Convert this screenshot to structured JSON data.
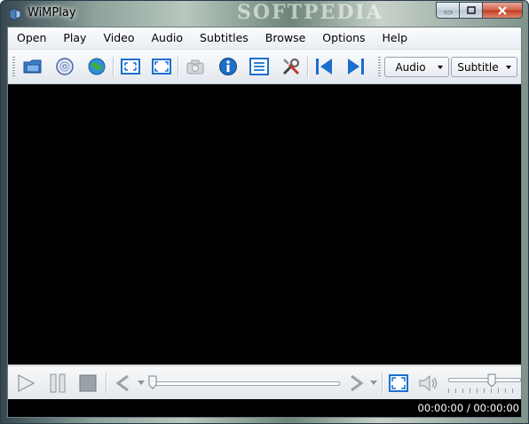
{
  "window": {
    "title": "WiMPlay"
  },
  "watermark": "SOFTPEDIA",
  "menu": [
    "Open",
    "Play",
    "Video",
    "Audio",
    "Subtitles",
    "Browse",
    "Options",
    "Help"
  ],
  "toolbar": {
    "audio_label": "Audio",
    "subtitle_label": "Subtitle"
  },
  "status": {
    "time": "00:00:00 / 00:00:00"
  },
  "seek": {
    "position": 0
  },
  "volume": {
    "level": 0.6
  },
  "icons": {
    "open": "folder-icon",
    "disc": "disc-icon",
    "web": "globe-icon",
    "fit": "fit-window-icon",
    "fullscreen": "fullscreen-icon",
    "snapshot": "camera-icon",
    "info": "info-icon",
    "playlist": "playlist-icon",
    "settings": "tools-icon",
    "prev": "previous-icon",
    "next": "next-icon"
  },
  "colors": {
    "accent": "#1a6fd0",
    "video_bg": "#000000"
  }
}
